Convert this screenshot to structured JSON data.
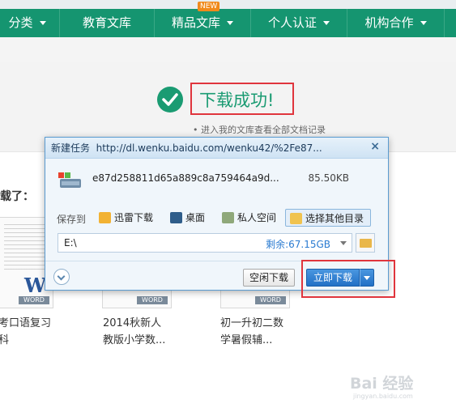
{
  "nav": {
    "items": [
      "分类",
      "教育文库",
      "精品文库",
      "个人认证",
      "机构合作"
    ],
    "badge": "NEW"
  },
  "success": {
    "message": "下载成功!",
    "records_link": "• 进入我的文库查看全部文档记录"
  },
  "page": {
    "heading_fragment": "载了：",
    "docs": [
      {
        "title_line1": "考口语复习",
        "title_line2": "科",
        "tag": "WORD",
        "logo": "W"
      },
      {
        "title_line1": "2014秋新人",
        "title_line2": "教版小学数...",
        "tag": "WORD"
      },
      {
        "title_line1": "初一升初二数",
        "title_line2": "学暑假辅...",
        "tag": "WORD"
      }
    ]
  },
  "dialog": {
    "title": "新建任务",
    "url": "http://dl.wenku.baidu.com/wenku42/%2Fe87...",
    "close_label": "×",
    "file_name": "e87d258811d65a889c8a759464a9d...",
    "file_size": "85.50KB",
    "save_to_label": "保存到",
    "save_options": [
      "迅雷下载",
      "桌面",
      "私人空间",
      "选择其他目录"
    ],
    "selected_option": "选择其他目录",
    "path_value": "E:\\",
    "free_space": "剩余:67.15GB",
    "idle_download_label": "空闲下载",
    "download_now_label": "立即下载"
  },
  "watermark": {
    "main": "Bai 经验",
    "sub": "jingyan.baidu.com"
  },
  "colors": {
    "nav_green": "#159570",
    "success_green": "#1a9b72",
    "highlight_red": "#e0353d",
    "primary_blue": "#2270c5"
  }
}
